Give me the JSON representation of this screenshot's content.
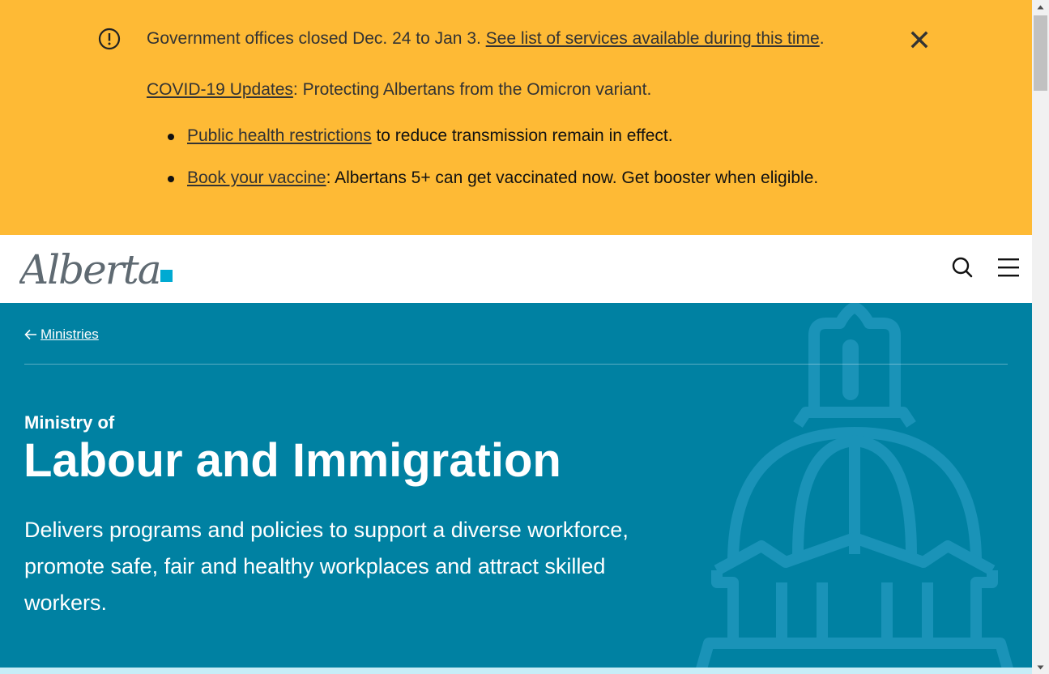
{
  "alert": {
    "closure_text": "Government offices closed Dec. 24 to Jan 3. ",
    "closure_link": "See list of services available during this time",
    "closure_end": ".",
    "covid_link": "COVID-19 Updates",
    "covid_text": ": Protecting Albertans from the Omicron variant.",
    "bullets": [
      {
        "link": "Public health restrictions",
        "text": " to reduce transmission remain in effect."
      },
      {
        "link": "Book your vaccine",
        "text": ": Albertans 5+ can get vaccinated now. Get booster when eligible."
      }
    ],
    "background_color": "#feba35",
    "close_icon": "close-icon",
    "warning_icon": "exclamation-circle-icon"
  },
  "header": {
    "logo_text": "Alberta",
    "search_icon": "search-icon",
    "menu_icon": "hamburger-menu-icon"
  },
  "hero": {
    "breadcrumb_label": "Ministries",
    "eyebrow": "Ministry of",
    "title": "Labour and Immigration",
    "lead": "Delivers programs and policies to support a diverse workforce, promote safe, fair and healthy workplaces and attract skilled workers.",
    "background_color": "#0081a2"
  }
}
